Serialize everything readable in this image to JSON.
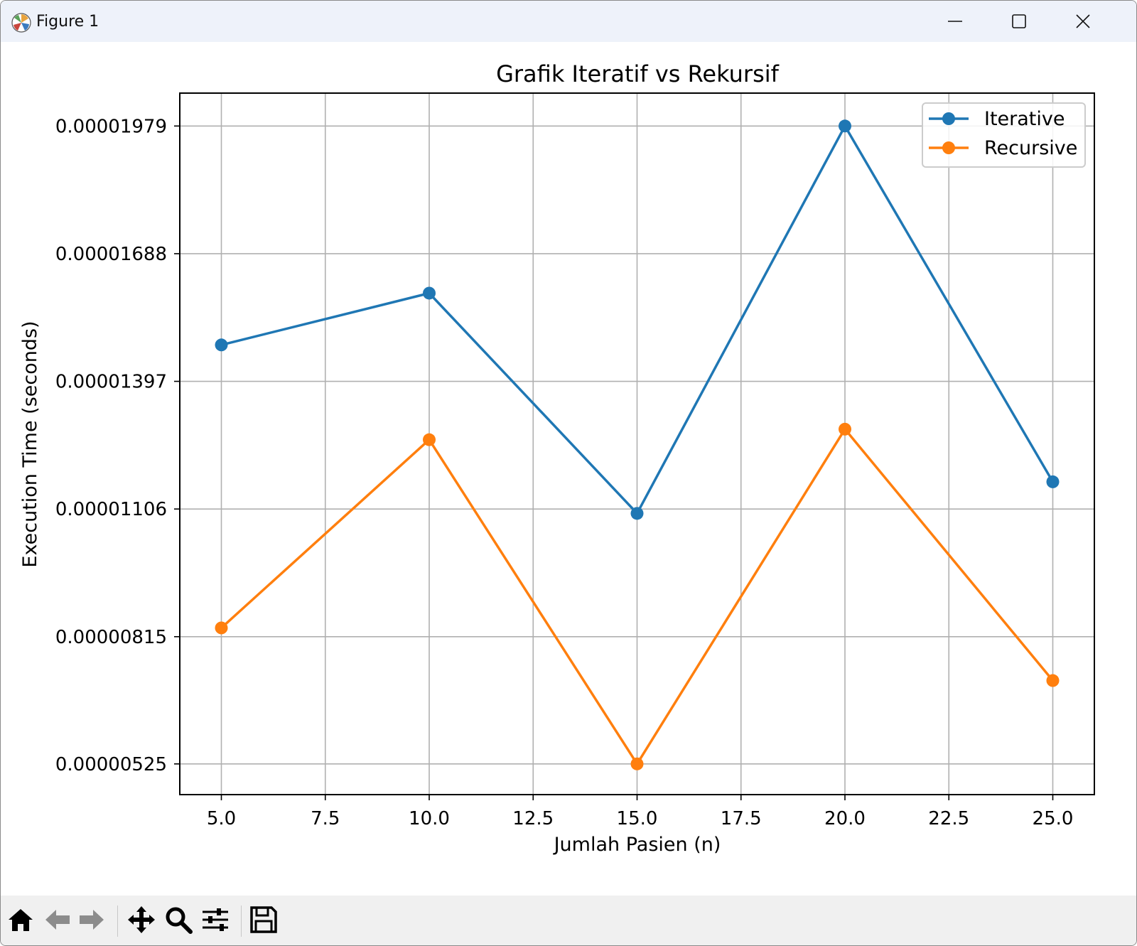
{
  "window": {
    "title": "Figure 1",
    "minimize_icon": "minimize-icon",
    "maximize_icon": "maximize-icon",
    "close_icon": "close-icon"
  },
  "toolbar": {
    "items": [
      "home-icon",
      "back-arrow-icon",
      "forward-arrow-icon",
      "pan-move-icon",
      "zoom-magnifier-icon",
      "configure-subplots-icon",
      "save-disk-icon"
    ]
  },
  "chart_data": {
    "type": "line",
    "title": "Grafik Iteratif vs Rekursif",
    "xlabel": "Jumlah Pasien (n)",
    "ylabel": "Execution Time (seconds)",
    "xlim": [
      4.0,
      26.0
    ],
    "ylim": [
      4.55e-06,
      2.054e-05
    ],
    "x_ticks": [
      5.0,
      7.5,
      10.0,
      12.5,
      15.0,
      17.5,
      20.0,
      22.5,
      25.0
    ],
    "x_tick_labels": [
      "5.0",
      "7.5",
      "10.0",
      "12.5",
      "15.0",
      "17.5",
      "20.0",
      "22.5",
      "25.0"
    ],
    "y_ticks": [
      5.25e-06,
      8.15e-06,
      1.106e-05,
      1.397e-05,
      1.688e-05,
      1.979e-05
    ],
    "y_tick_labels": [
      "0.00000525",
      "0.00000815",
      "0.00001106",
      "0.00001397",
      "0.00001688",
      "0.00001979"
    ],
    "grid": true,
    "legend_position": "top-right",
    "x": [
      5,
      10,
      15,
      20,
      25
    ],
    "series": [
      {
        "name": "Iterative",
        "color": "#1f77b4",
        "values": [
          1.48e-05,
          1.598e-05,
          1.096e-05,
          1.979e-05,
          1.168e-05
        ]
      },
      {
        "name": "Recursive",
        "color": "#ff7f0e",
        "values": [
          8.35e-06,
          1.264e-05,
          5.25e-06,
          1.288e-05,
          7.15e-06
        ]
      }
    ]
  }
}
